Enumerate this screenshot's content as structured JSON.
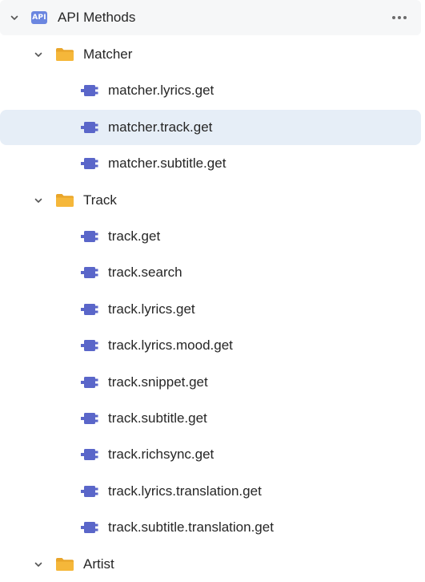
{
  "root": {
    "label": "API Methods",
    "badge": "API"
  },
  "folders": [
    {
      "label": "Matcher",
      "items": [
        "matcher.lyrics.get",
        "matcher.track.get",
        "matcher.subtitle.get"
      ]
    },
    {
      "label": "Track",
      "items": [
        "track.get",
        "track.search",
        "track.lyrics.get",
        "track.lyrics.mood.get",
        "track.snippet.get",
        "track.subtitle.get",
        "track.richsync.get",
        "track.lyrics.translation.get",
        "track.subtitle.translation.get"
      ]
    },
    {
      "label": "Artist",
      "items": []
    }
  ],
  "selected_item": "matcher.track.get",
  "colors": {
    "root_bg": "#f6f7f8",
    "selected_bg": "#e6eef7",
    "api_badge": "#6b86e0",
    "folder": "#f5b73a",
    "endpoint_icon": "#5a66c9"
  },
  "icons": {
    "expand": "chevron-down-icon",
    "more": "more-horizontal-icon",
    "folder": "folder-icon",
    "endpoint": "endpoint-plug-icon"
  }
}
